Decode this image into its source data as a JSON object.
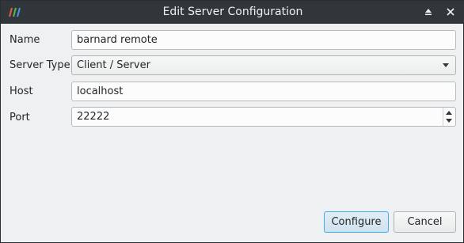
{
  "window": {
    "title": "Edit Server Configuration"
  },
  "form": {
    "name": {
      "label": "Name",
      "value": "barnard remote"
    },
    "server_type": {
      "label": "Server Type",
      "value": "Client / Server"
    },
    "host": {
      "label": "Host",
      "value": "localhost"
    },
    "port": {
      "label": "Port",
      "value": "22222"
    }
  },
  "buttons": {
    "configure": "Configure",
    "cancel": "Cancel"
  },
  "icons": {
    "app": "paraview-logo-icon",
    "keep_above": "eject-icon",
    "close": "close-icon"
  },
  "colors": {
    "titlebar": "#31363b",
    "dialog_bg": "#eff0f1",
    "focus": "#3daee9"
  }
}
